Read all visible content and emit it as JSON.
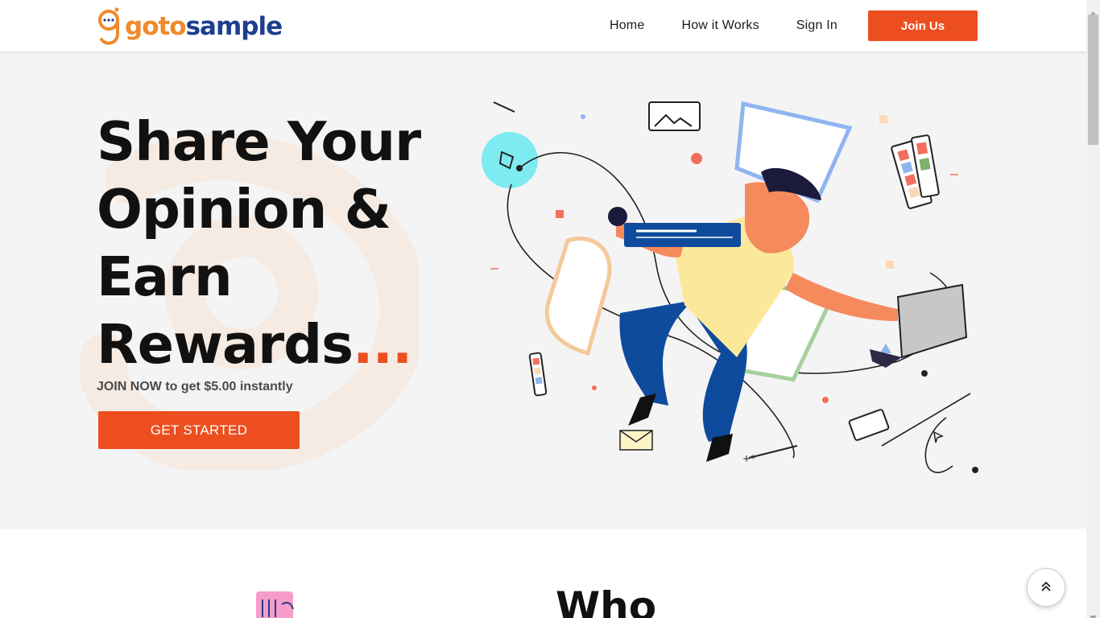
{
  "header": {
    "logo": {
      "part1": "goto",
      "part2": "sample"
    },
    "nav": [
      {
        "label": "Home"
      },
      {
        "label": "How it Works"
      },
      {
        "label": "Sign In"
      }
    ],
    "join_label": "Join Us"
  },
  "hero": {
    "title_lines": [
      "Share Your",
      "Opinion &",
      "Earn",
      "Rewards"
    ],
    "title_dots": "...",
    "subtitle": "JOIN NOW to get $5.00 instantly",
    "cta_label": "GET STARTED"
  },
  "section2": {
    "heading_partial": "Who"
  },
  "icons": [
    "chat-dots-icon",
    "fist-icon",
    "chevron-up-icon",
    "scroll-up-arrow-icon",
    "scroll-down-arrow-icon"
  ],
  "colors": {
    "accent": "#ed4e1f",
    "logo_orange": "#f08a2c",
    "logo_blue": "#1e3f8f",
    "hero_bg": "#f4f4f4",
    "illus_blue": "#0e4b9c",
    "illus_yellow": "#fce89a",
    "illus_skin": "#f58a5c",
    "illus_cyan": "#7eebf1"
  }
}
